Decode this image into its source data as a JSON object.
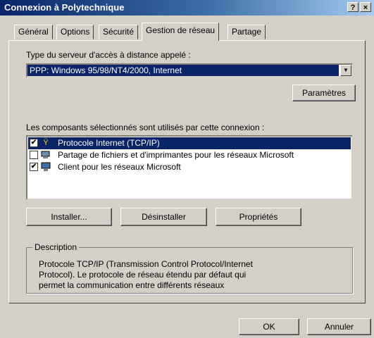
{
  "window": {
    "title": "Connexion à Polytechnique",
    "help_label": "?",
    "close_label": "×"
  },
  "tabs": [
    {
      "label": "Général"
    },
    {
      "label": "Options"
    },
    {
      "label": "Sécurité"
    },
    {
      "label": "Gestion de réseau",
      "active": true
    },
    {
      "label": "Partage"
    }
  ],
  "server": {
    "label": "Type du serveur d'accès à distance appelé :",
    "selected": "PPP: Windows 95/98/NT4/2000, Internet",
    "arrow_icon": "combo-arrow-icon"
  },
  "parametres_label": "Paramètres",
  "components": {
    "label": "Les composants sélectionnés sont utilisés par cette connexion :",
    "items": [
      {
        "checked": true,
        "icon": "network-protocol-icon",
        "label": "Protocole Internet (TCP/IP)",
        "selected": true
      },
      {
        "checked": false,
        "icon": "network-service-icon",
        "label": "Partage de fichiers et d'imprimantes pour les réseaux Microsoft",
        "selected": false
      },
      {
        "checked": true,
        "icon": "network-client-icon",
        "label": "Client pour les réseaux Microsoft",
        "selected": false
      }
    ]
  },
  "actions": {
    "install": "Installer...",
    "uninstall": "Désinstaller",
    "properties": "Propriétés"
  },
  "description": {
    "title": "Description",
    "lines": [
      "Protocole TCP/IP (Transmission Control Protocol/Internet",
      "Protocol). Le protocole de réseau étendu par défaut qui",
      "permet la communication entre différents réseaux"
    ]
  },
  "footer": {
    "ok": "OK",
    "cancel": "Annuler"
  }
}
